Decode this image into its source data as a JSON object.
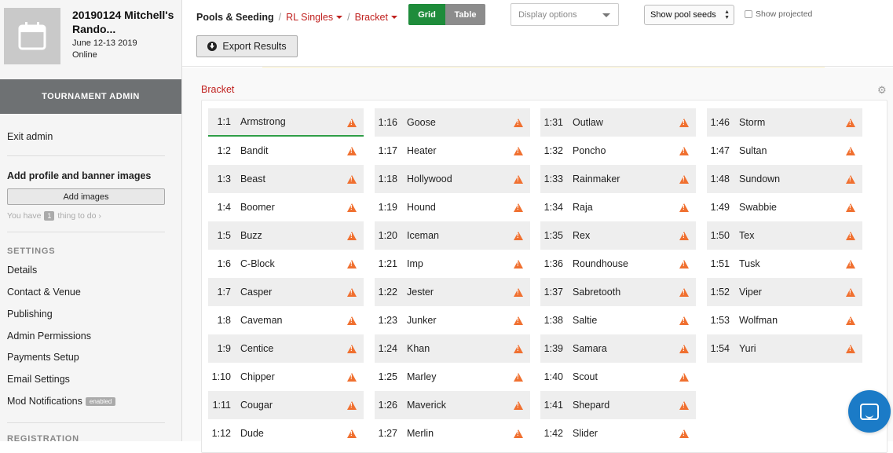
{
  "tournament": {
    "name": "20190124 Mitchell's Rando...",
    "dates": "June 12-13 2019",
    "location": "Online"
  },
  "sidebar": {
    "admin_title": "TOURNAMENT ADMIN",
    "exit_admin": "Exit admin",
    "profile_heading": "Add profile and banner images",
    "add_images_button": "Add images",
    "todo_prefix": "You have",
    "todo_count": "1",
    "todo_suffix": "thing to do ›",
    "settings_heading": "SETTINGS",
    "settings_items": [
      "Details",
      "Contact & Venue",
      "Publishing",
      "Admin Permissions",
      "Payments Setup",
      "Email Settings"
    ],
    "mod_notifications": "Mod Notifications",
    "mod_badge": "enabled",
    "registration_heading": "REGISTRATION"
  },
  "breadcrumb": {
    "root": "Pools & Seeding",
    "event": "RL Singles",
    "phase": "Bracket",
    "separator": "/"
  },
  "toolbar": {
    "grid_label": "Grid",
    "table_label": "Table",
    "active_view": "Grid",
    "display_options_placeholder": "Display options",
    "seed_select_value": "Show pool seeds",
    "show_projected_label": "Show projected",
    "show_projected_checked": false,
    "export_label": "Export Results"
  },
  "bracket": {
    "label": "Bracket",
    "columns": [
      [
        [
          "1:1",
          "Armstrong"
        ],
        [
          "1:2",
          "Bandit"
        ],
        [
          "1:3",
          "Beast"
        ],
        [
          "1:4",
          "Boomer"
        ],
        [
          "1:5",
          "Buzz"
        ],
        [
          "1:6",
          "C-Block"
        ],
        [
          "1:7",
          "Casper"
        ],
        [
          "1:8",
          "Caveman"
        ],
        [
          "1:9",
          "Centice"
        ],
        [
          "1:10",
          "Chipper"
        ],
        [
          "1:11",
          "Cougar"
        ],
        [
          "1:12",
          "Dude"
        ]
      ],
      [
        [
          "1:16",
          "Goose"
        ],
        [
          "1:17",
          "Heater"
        ],
        [
          "1:18",
          "Hollywood"
        ],
        [
          "1:19",
          "Hound"
        ],
        [
          "1:20",
          "Iceman"
        ],
        [
          "1:21",
          "Imp"
        ],
        [
          "1:22",
          "Jester"
        ],
        [
          "1:23",
          "Junker"
        ],
        [
          "1:24",
          "Khan"
        ],
        [
          "1:25",
          "Marley"
        ],
        [
          "1:26",
          "Maverick"
        ],
        [
          "1:27",
          "Merlin"
        ]
      ],
      [
        [
          "1:31",
          "Outlaw"
        ],
        [
          "1:32",
          "Poncho"
        ],
        [
          "1:33",
          "Rainmaker"
        ],
        [
          "1:34",
          "Raja"
        ],
        [
          "1:35",
          "Rex"
        ],
        [
          "1:36",
          "Roundhouse"
        ],
        [
          "1:37",
          "Sabretooth"
        ],
        [
          "1:38",
          "Saltie"
        ],
        [
          "1:39",
          "Samara"
        ],
        [
          "1:40",
          "Scout"
        ],
        [
          "1:41",
          "Shepard"
        ],
        [
          "1:42",
          "Slider"
        ]
      ],
      [
        [
          "1:46",
          "Storm"
        ],
        [
          "1:47",
          "Sultan"
        ],
        [
          "1:48",
          "Sundown"
        ],
        [
          "1:49",
          "Swabbie"
        ],
        [
          "1:50",
          "Tex"
        ],
        [
          "1:51",
          "Tusk"
        ],
        [
          "1:52",
          "Viper"
        ],
        [
          "1:53",
          "Wolfman"
        ],
        [
          "1:54",
          "Yuri"
        ]
      ]
    ]
  },
  "colors": {
    "accent_red": "#c0211f",
    "grid_active": "#1e8c3b",
    "warning": "#f07030",
    "chat": "#1b7bc7"
  },
  "icons": {
    "tile": "calendar-icon",
    "warning": "warning-icon",
    "settings": "gear-icon",
    "export": "download-circle-icon",
    "chat": "chat-icon"
  }
}
